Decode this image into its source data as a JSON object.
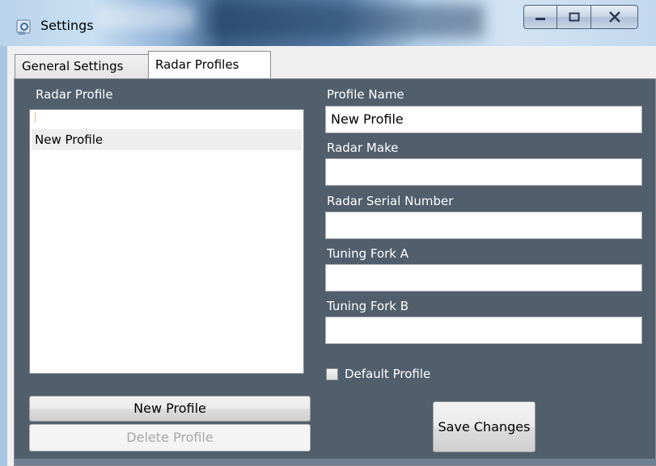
{
  "window": {
    "title": "Settings",
    "icon": "settings-app-icon"
  },
  "tabs": [
    {
      "label": "General Settings",
      "selected": false
    },
    {
      "label": "Radar Profiles",
      "selected": true
    }
  ],
  "profiles": {
    "list_label": "Radar Profile",
    "items": [
      "",
      "New Profile"
    ],
    "selected_index": 1,
    "new_button": "New Profile",
    "delete_button": "Delete Profile",
    "delete_enabled": false
  },
  "form": {
    "profile_name_label": "Profile Name",
    "profile_name_value": "New Profile",
    "radar_make_label": "Radar Make",
    "radar_make_value": "",
    "serial_label": "Radar Serial Number",
    "serial_value": "",
    "fork_a_label": "Tuning Fork A",
    "fork_a_value": "",
    "fork_b_label": "Tuning Fork B",
    "fork_b_value": "",
    "default_label": "Default Profile",
    "default_checked": false,
    "save_button": "Save Changes"
  },
  "colors": {
    "panel_background": "#515e6b",
    "titlebar_accent": "#3c5f86"
  }
}
